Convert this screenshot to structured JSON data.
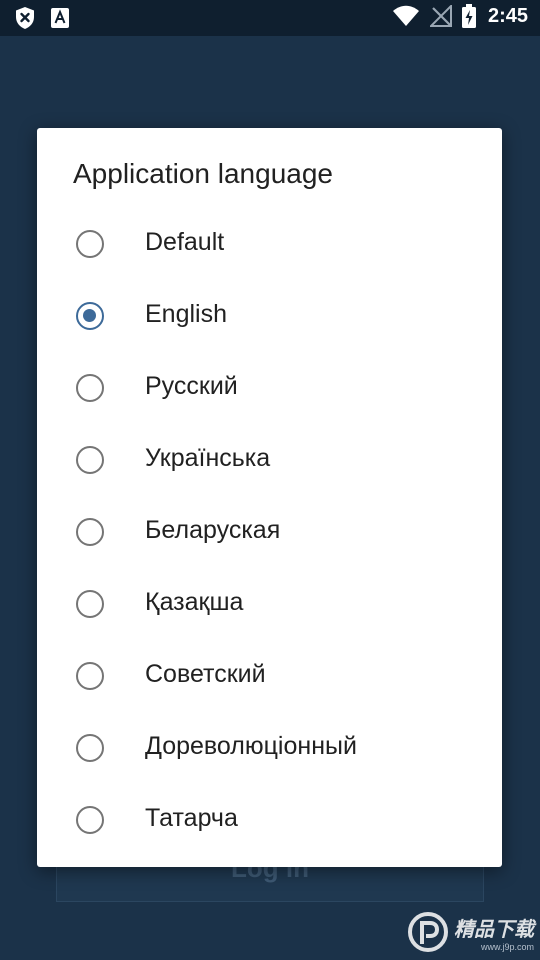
{
  "status_bar": {
    "time": "2:45",
    "left_icons": [
      "shield-x-icon",
      "font-a-icon"
    ],
    "right_icons": [
      "wifi-icon",
      "no-signal-icon",
      "battery-charging-icon"
    ]
  },
  "background": {
    "login_button_label": "Log in"
  },
  "dialog": {
    "title": "Application language",
    "accent_color": "#3d6a99",
    "selected_index": 1,
    "options": [
      {
        "label": "Default"
      },
      {
        "label": "English"
      },
      {
        "label": "Русский"
      },
      {
        "label": "Українська"
      },
      {
        "label": "Беларуская"
      },
      {
        "label": "Қазақша"
      },
      {
        "label": "Советский"
      },
      {
        "label": "Дореволюціонный"
      },
      {
        "label": "Татарча"
      }
    ]
  },
  "watermark": {
    "text": "精品下载",
    "subtext": "www.j9p.com"
  }
}
